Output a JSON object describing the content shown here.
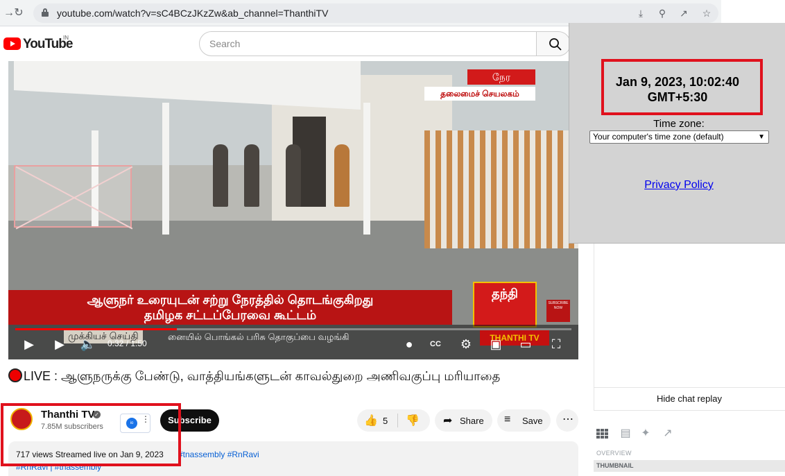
{
  "browser": {
    "url": "youtube.com/watch?v=sC4BCzJKzZw&ab_channel=ThanthiTV"
  },
  "header": {
    "logo_text": "YouTube",
    "region": "IN",
    "search_placeholder": "Search"
  },
  "video": {
    "overlay_badge": "நேர",
    "location_tag": "தலைமைச் செயலகம்",
    "ticker_line1": "ஆளுநர் உரையுடன் சற்று நேரத்தில் தொடங்குகிறது",
    "ticker_line2": "தமிழக சட்டப்பேரவை கூட்டம்",
    "brand_logo": "தந்தி",
    "subscribe_now": "SUBSCRIBE NOW",
    "bottom_tag": "முக்கியச் செய்தி",
    "bottom_text": "னையில் பொங்கல் பரிசு தொகுப்பை வழங்கி",
    "bottom_brand": "THANTHI TV",
    "time_display": "0:32 / 1:50",
    "progress_fraction": 0.29
  },
  "details": {
    "title_prefix": "LIVE : ",
    "title": "ஆளுநருக்கு பேண்டு, வாத்தியங்களுடன் காவல்துறை அணிவகுப்பு மரியாதை",
    "channel_name": "Thanthi TV",
    "subscribers": "7.85M subscribers",
    "subscribe_label": "Subscribe",
    "like_count": "5",
    "share_label": "Share",
    "save_label": "Save",
    "views_line": "717 views  Streamed live on Jan 9, 2023",
    "hashtags": "#tnassembly #RnRavi",
    "hashtags2": "#RnRavi | #tnassembly"
  },
  "sidebar": {
    "hide_chat": "Hide chat replay",
    "overview": "OVERVIEW",
    "thumbnail": "THUMBNAIL"
  },
  "timezone_popup": {
    "datetime_line1": "Jan 9, 2023, 10:02:40",
    "datetime_line2": "GMT+5:30",
    "tz_label": "Time zone:",
    "tz_selected": "Your computer's time zone (default)",
    "privacy_link": "Privacy Policy"
  },
  "colors": {
    "highlight_box": "#e0111d",
    "youtube_red": "#ff0000",
    "link_blue": "#065fd4"
  }
}
